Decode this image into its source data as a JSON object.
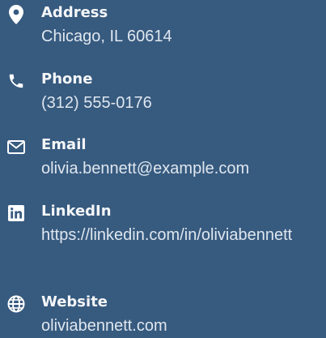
{
  "contact": {
    "items": [
      {
        "icon": "location-pin-icon",
        "label": "Address",
        "value": "Chicago, IL 60614"
      },
      {
        "icon": "phone-icon",
        "label": "Phone",
        "value": "(312) 555-0176"
      },
      {
        "icon": "envelope-icon",
        "label": "Email",
        "value": "olivia.bennett@example.com"
      },
      {
        "icon": "linkedin-icon",
        "label": "LinkedIn",
        "value": "https://linkedin.com/in/oliviabennett"
      },
      {
        "icon": "globe-icon",
        "label": "Website",
        "value": "oliviabennett.com"
      }
    ]
  },
  "colors": {
    "background": "#375a7f",
    "text": "#ffffff"
  }
}
